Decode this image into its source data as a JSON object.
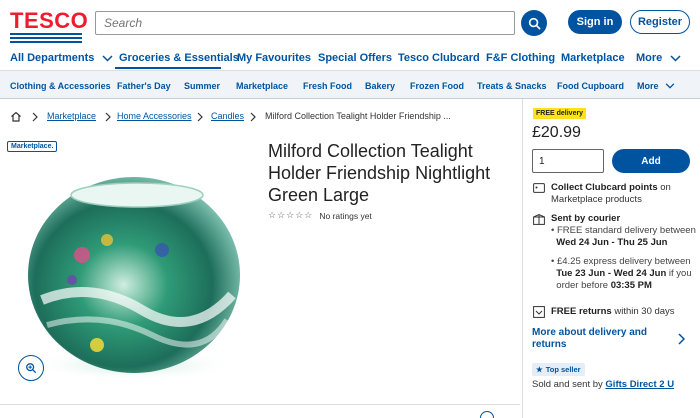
{
  "header": {
    "logo": "TESCO",
    "search_placeholder": "Search",
    "signin_label": "Sign in",
    "register_label": "Register"
  },
  "nav_primary": {
    "items": [
      "All Departments",
      "Groceries & Essentials",
      "My Favourites",
      "Special Offers",
      "Tesco Clubcard",
      "F&F Clothing",
      "Marketplace",
      "More"
    ],
    "active": "Groceries & Essentials"
  },
  "nav_secondary": {
    "items": [
      "Clothing & Accessories",
      "Father's Day",
      "Summer",
      "Marketplace",
      "Fresh Food",
      "Bakery",
      "Frozen Food",
      "Treats & Snacks",
      "Food Cupboard",
      "More"
    ]
  },
  "breadcrumb": [
    "Marketplace",
    "Home Accessories",
    "Candles",
    "Milford Collection Tealight Holder Friendship ..."
  ],
  "product": {
    "marketplace_badge": "Marketplace.",
    "title": "Milford Collection Tealight Holder Friendship Nightlight Green Large",
    "rating_text": "No ratings yet",
    "stars": "☆☆☆☆☆"
  },
  "buy_box": {
    "delivery_badge": "FREE delivery",
    "price": "£20.99",
    "quantity": "1",
    "add_label": "Add",
    "clubcard_bold": "Collect Clubcard points",
    "clubcard_rest": " on Marketplace products",
    "courier_title": "Sent by courier",
    "standard_line1": "FREE standard delivery between",
    "standard_dates": "Wed 24 Jun - Thu 25 Jun",
    "express_line1": "£4.25 express delivery between",
    "express_dates": "Tue 23 Jun - Wed 24 Jun",
    "express_line2_rest": " if you",
    "express_line3": "order before ",
    "express_time": "03:35 PM",
    "returns_bold": "FREE returns",
    "returns_rest": " within 30 days",
    "more_delivery": "More about delivery and returns",
    "top_seller": "Top seller",
    "sold_by_prefix": "Sold and sent by ",
    "seller": "Gifts Direct 2 U"
  },
  "colors": {
    "brand_blue": "#00539F",
    "tesco_red": "#EE1C2E",
    "badge_yellow": "#FFE11B"
  }
}
